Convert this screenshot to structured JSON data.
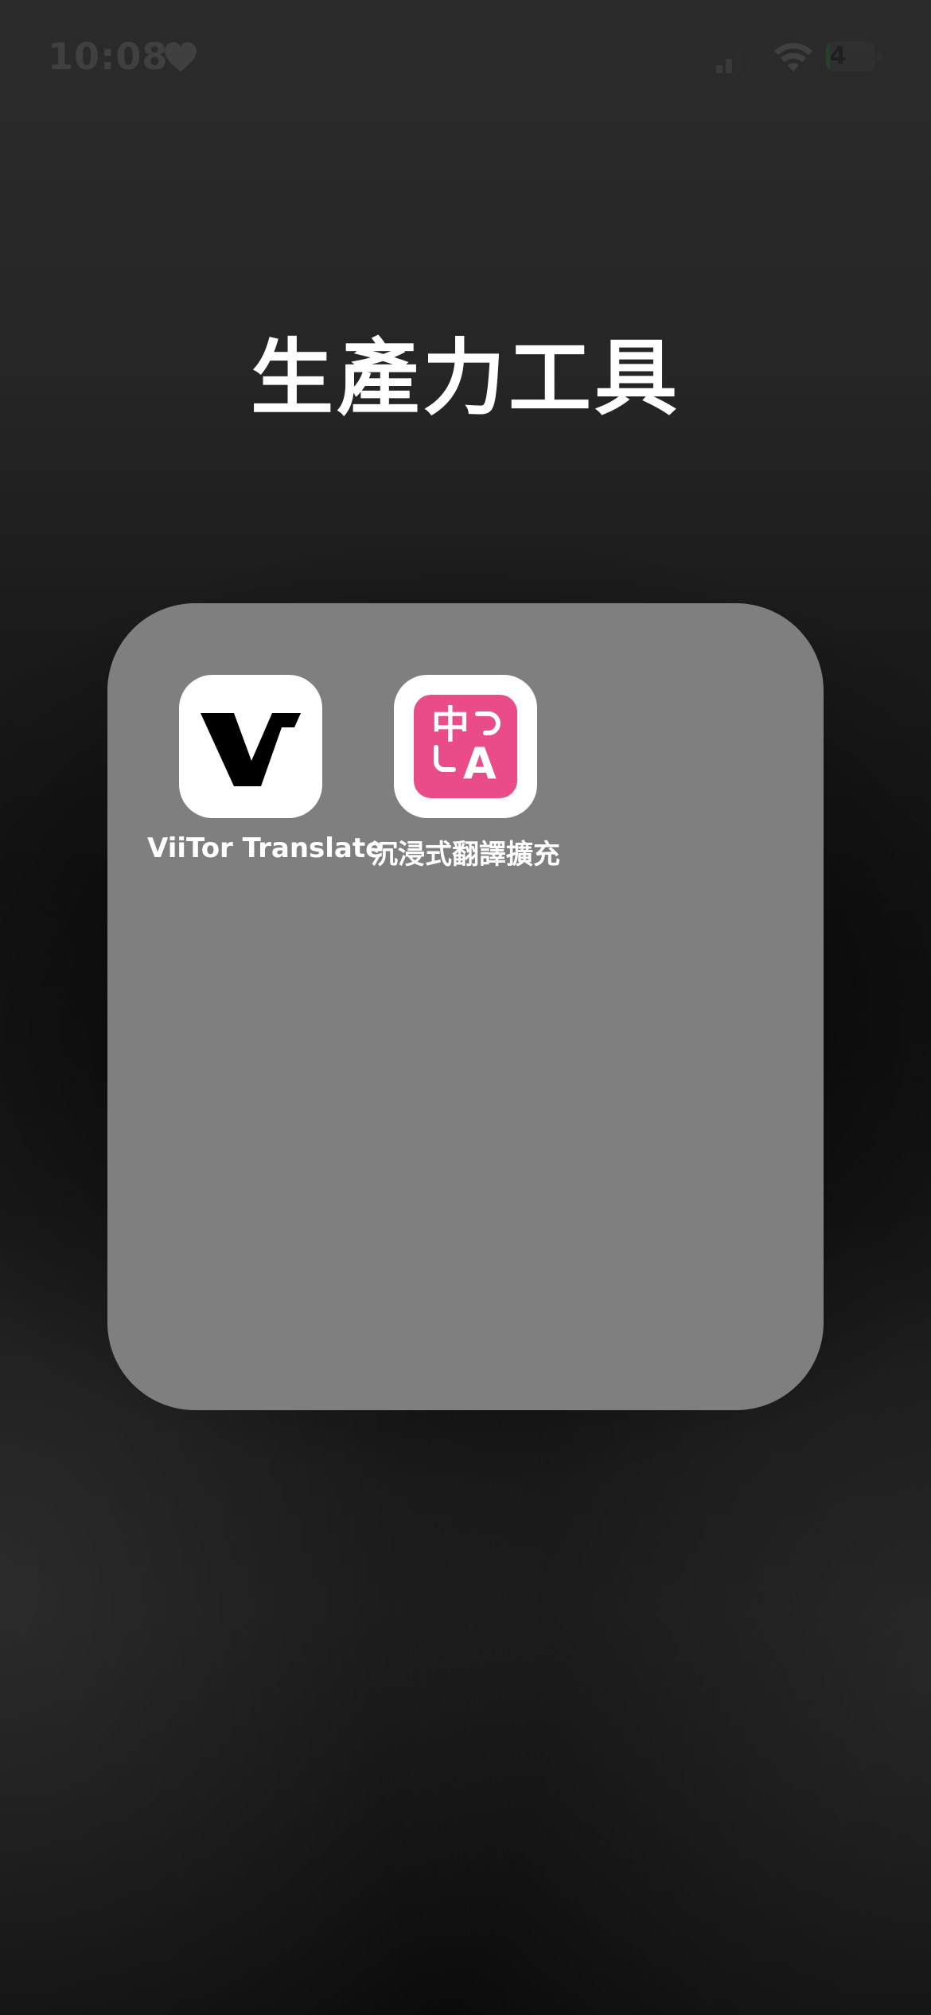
{
  "status_bar": {
    "time": "10:08",
    "heart_icon": "heart-icon",
    "signal_icon": "cellular-signal-icon",
    "wifi_icon": "wifi-icon",
    "battery_level": "4",
    "battery_color": "#1f6b2a"
  },
  "folder": {
    "title": "生產力工具",
    "background_color": "#7f7f7f",
    "apps": [
      {
        "label": "ViiTor Translate",
        "icon": "viitor-translate-icon",
        "icon_background": "#ffffff",
        "glyph": "V"
      },
      {
        "label": "沉浸式翻譯擴充",
        "icon": "immersive-translate-icon",
        "icon_background": "#ffffff",
        "badge_color": "#ea4c89",
        "glyph_top": "中",
        "glyph_bottom": "A"
      }
    ]
  }
}
